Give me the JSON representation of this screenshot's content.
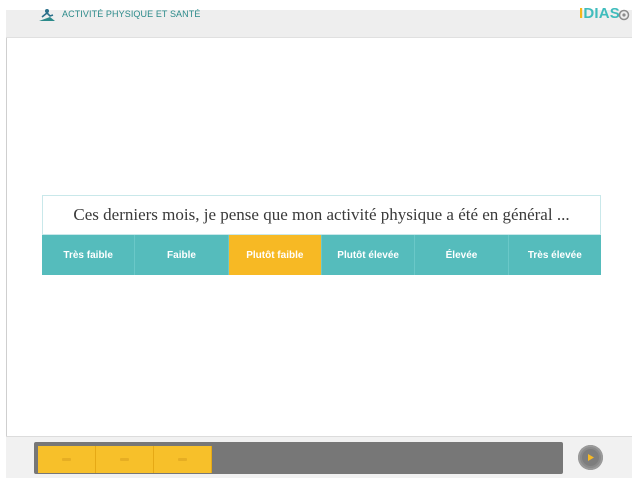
{
  "header": {
    "title": "ACTIVITÉ PHYSIQUE ET SANTÉ",
    "logo_part1": "I",
    "logo_part2": "DIAS",
    "brand_icon": "mountain-climber-icon",
    "settings_icon": "gear-icon"
  },
  "question": {
    "text": "Ces derniers mois, je pense que mon activité physique a été en général ..."
  },
  "options": [
    {
      "label": "Très faible",
      "selected": false
    },
    {
      "label": "Faible",
      "selected": false
    },
    {
      "label": "Plutôt faible",
      "selected": true
    },
    {
      "label": "Plutôt élevée",
      "selected": false
    },
    {
      "label": "Élevée",
      "selected": false
    },
    {
      "label": "Très élevée",
      "selected": false
    }
  ],
  "progress": {
    "completed_steps": 3,
    "step_icon": "minus-icon"
  },
  "footer": {
    "next_icon": "play-arrow-icon"
  },
  "colors": {
    "teal": "#55bcbc",
    "selected": "#f7b924",
    "logo_yellow": "#f5b81c",
    "logo_teal": "#3fbcbc",
    "title_teal": "#2b8a8a"
  }
}
